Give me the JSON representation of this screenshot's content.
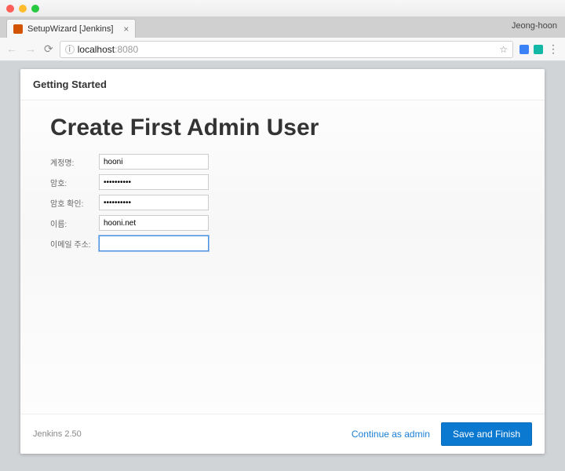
{
  "browser": {
    "tab_title": "SetupWizard [Jenkins]",
    "profile_name": "Jeong-hoon",
    "url_host": "localhost",
    "url_port": ":8080"
  },
  "modal": {
    "header": "Getting Started",
    "title": "Create First Admin User",
    "version": "Jenkins 2.50",
    "continue_label": "Continue as admin",
    "save_label": "Save and Finish"
  },
  "form": {
    "username_label": "계정명:",
    "username_value": "hooni",
    "password_label": "암호:",
    "password_value": "••••••••••",
    "confirm_label": "암호 확인:",
    "confirm_value": "••••••••••",
    "fullname_label": "이름:",
    "fullname_value": "hooni.net",
    "email_label": "이메일 주소:",
    "email_value": ""
  }
}
